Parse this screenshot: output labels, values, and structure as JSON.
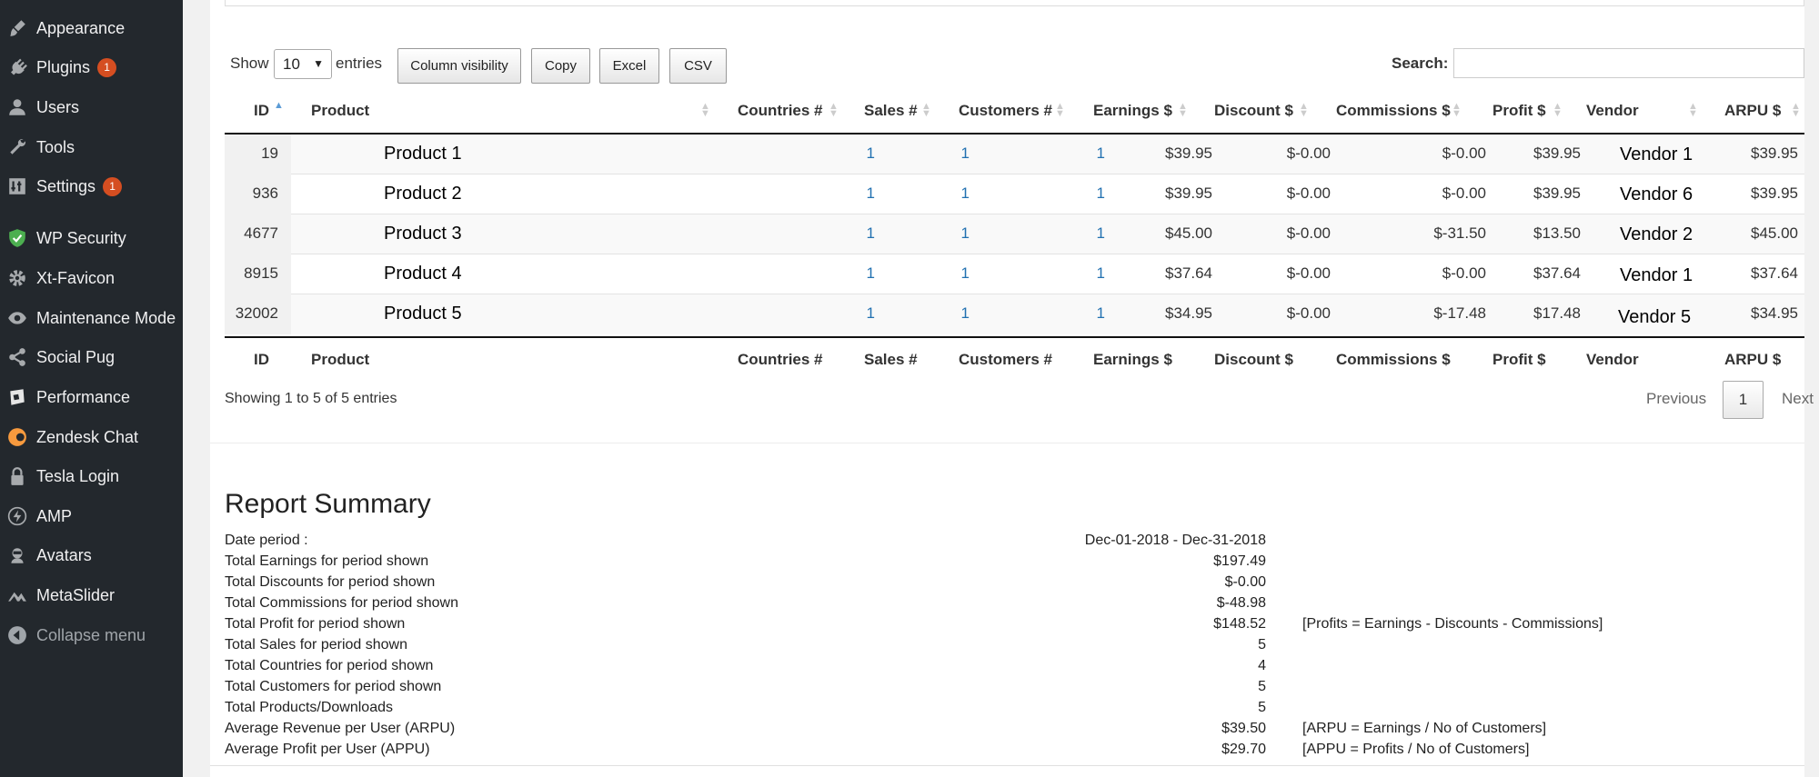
{
  "sidebar": {
    "items": [
      {
        "label": "Appearance",
        "icon": "paintbrush-icon",
        "badge": ""
      },
      {
        "label": "Plugins",
        "icon": "plug-icon",
        "badge": "1"
      },
      {
        "label": "Users",
        "icon": "user-icon",
        "badge": ""
      },
      {
        "label": "Tools",
        "icon": "wrench-icon",
        "badge": ""
      },
      {
        "label": "Settings",
        "icon": "settings-icon",
        "badge": "1"
      },
      {
        "label": "WP Security",
        "icon": "shield-icon",
        "badge": ""
      },
      {
        "label": "Xt-Favicon",
        "icon": "gear-icon",
        "badge": ""
      },
      {
        "label": "Maintenance Mode",
        "icon": "eye-icon",
        "badge": ""
      },
      {
        "label": "Social Pug",
        "icon": "share-icon",
        "badge": ""
      },
      {
        "label": "Performance",
        "icon": "performance-icon",
        "badge": ""
      },
      {
        "label": "Zendesk Chat",
        "icon": "chat-icon",
        "badge": ""
      },
      {
        "label": "Tesla Login",
        "icon": "lock-icon",
        "badge": ""
      },
      {
        "label": "AMP",
        "icon": "bolt-icon",
        "badge": ""
      },
      {
        "label": "Avatars",
        "icon": "avatar-icon",
        "badge": ""
      },
      {
        "label": "MetaSlider",
        "icon": "mountain-icon",
        "badge": ""
      }
    ],
    "collapse_label": "Collapse menu"
  },
  "toolbar": {
    "show_label": "Show",
    "length_value": "10",
    "entries_label": "entries",
    "buttons": [
      "Column visibility",
      "Copy",
      "Excel",
      "CSV"
    ],
    "search_label": "Search:",
    "search_value": ""
  },
  "table": {
    "columns": [
      "ID",
      "Product",
      "Countries #",
      "Sales #",
      "Customers #",
      "Earnings $",
      "Discount $",
      "Commissions $",
      "Profit $",
      "Vendor",
      "ARPU $"
    ],
    "rows": [
      {
        "id": "19",
        "product": "Product 1",
        "countries": "1",
        "sales": "1",
        "customers": "1",
        "earnings": "$39.95",
        "discount": "$-0.00",
        "commissions": "$-0.00",
        "profit": "$39.95",
        "vendor": "Vendor 1",
        "arpu": "$39.95"
      },
      {
        "id": "936",
        "product": "Product 2",
        "countries": "1",
        "sales": "1",
        "customers": "1",
        "earnings": "$39.95",
        "discount": "$-0.00",
        "commissions": "$-0.00",
        "profit": "$39.95",
        "vendor": "Vendor 6",
        "arpu": "$39.95"
      },
      {
        "id": "4677",
        "product": "Product 3",
        "countries": "1",
        "sales": "1",
        "customers": "1",
        "earnings": "$45.00",
        "discount": "$-0.00",
        "commissions": "$-31.50",
        "profit": "$13.50",
        "vendor": "Vendor 2",
        "arpu": "$45.00"
      },
      {
        "id": "8915",
        "product": "Product 4",
        "countries": "1",
        "sales": "1",
        "customers": "1",
        "earnings": "$37.64",
        "discount": "$-0.00",
        "commissions": "$-0.00",
        "profit": "$37.64",
        "vendor": "Vendor 1",
        "arpu": "$37.64"
      },
      {
        "id": "32002",
        "product": "Product 5",
        "countries": "1",
        "sales": "1",
        "customers": "1",
        "earnings": "$34.95",
        "discount": "$-0.00",
        "commissions": "$-17.48",
        "profit": "$17.48",
        "vendor": "Vendor 5",
        "arpu": "$34.95"
      }
    ],
    "info": "Showing 1 to 5 of 5 entries",
    "pagination": {
      "previous": "Previous",
      "current": "1",
      "next": "Next"
    }
  },
  "summary": {
    "title": "Report Summary",
    "rows": [
      {
        "label": "Date period :",
        "value": "Dec-01-2018 - Dec-31-2018",
        "note": ""
      },
      {
        "label": "Total Earnings for period shown",
        "value": "$197.49",
        "note": ""
      },
      {
        "label": "Total Discounts for period shown",
        "value": "$-0.00",
        "note": ""
      },
      {
        "label": "Total Commissions for period shown",
        "value": "$-48.98",
        "note": ""
      },
      {
        "label": "Total Profit for period shown",
        "value": "$148.52",
        "note": "[Profits = Earnings - Discounts - Commissions]"
      },
      {
        "label": "Total Sales for period shown",
        "value": "5",
        "note": ""
      },
      {
        "label": "Total Countries for period shown",
        "value": "4",
        "note": ""
      },
      {
        "label": "Total Customers for period shown",
        "value": "5",
        "note": ""
      },
      {
        "label": "Total Products/Downloads",
        "value": "5",
        "note": ""
      },
      {
        "label": "Average Revenue per User (ARPU)",
        "value": "$39.50",
        "note": "[ARPU = Earnings / No of Customers]"
      },
      {
        "label": "Average Profit per User (APPU)",
        "value": "$29.70",
        "note": "[APPU = Profits / No of Customers]"
      }
    ]
  }
}
